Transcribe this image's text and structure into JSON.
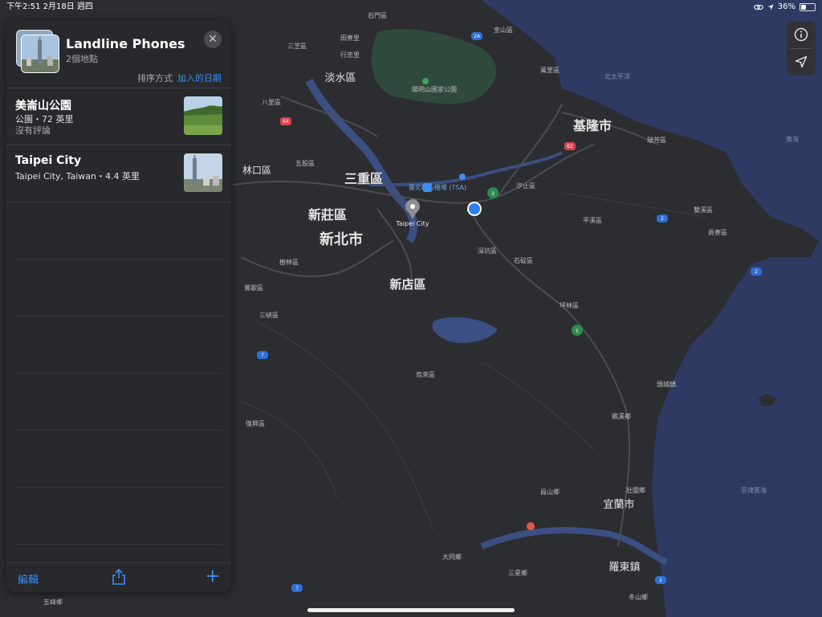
{
  "status_bar": {
    "time_date": "下午2:51  2月18日 週四",
    "battery_text": "36%",
    "battery_level": 0.36
  },
  "panel": {
    "title": "Landline Phones",
    "subtitle": "2個地點",
    "sort_label": "排序方式",
    "sort_value": "加入的日期",
    "items": [
      {
        "title": "美崙山公園",
        "detail": "公園・72 英里",
        "review": "沒有評論",
        "thumb": "park-photo"
      },
      {
        "title": "Taipei City",
        "detail": "Taipei City, Taiwan・4.4 英里",
        "review": "",
        "thumb": "city-skyline-photo"
      }
    ],
    "toolbar": {
      "edit_label": "編輯",
      "add_label": "+"
    }
  },
  "map": {
    "labels_large": [
      {
        "text": "基隆市"
      },
      {
        "text": "三重區"
      },
      {
        "text": "新莊區"
      },
      {
        "text": "新北市"
      },
      {
        "text": "新店區"
      },
      {
        "text": "淡水區"
      },
      {
        "text": "宜蘭市"
      },
      {
        "text": "羅東鎮"
      },
      {
        "text": "林口區"
      }
    ],
    "labels_small": [
      {
        "text": "金山區"
      },
      {
        "text": "萬里區"
      },
      {
        "text": "三芝區"
      },
      {
        "text": "石門區"
      },
      {
        "text": "田寮里"
      },
      {
        "text": "行忠里"
      },
      {
        "text": "陽明山國家公園"
      },
      {
        "text": "八里區"
      },
      {
        "text": "五股區"
      },
      {
        "text": "汐止區"
      },
      {
        "text": "平溪區"
      },
      {
        "text": "雙溪區"
      },
      {
        "text": "貢寮區"
      },
      {
        "text": "瑞芳區"
      },
      {
        "text": "深坑區"
      },
      {
        "text": "石碇區"
      },
      {
        "text": "樹林區"
      },
      {
        "text": "鶯歌區"
      },
      {
        "text": "三峽區"
      },
      {
        "text": "坪林區"
      },
      {
        "text": "烏來區"
      },
      {
        "text": "復興區"
      },
      {
        "text": "頭城鎮"
      },
      {
        "text": "礁溪鄉"
      },
      {
        "text": "員山鄉"
      },
      {
        "text": "壯圍鄉"
      },
      {
        "text": "大同鄉"
      },
      {
        "text": "三星鄉"
      },
      {
        "text": "冬山鄉"
      },
      {
        "text": "五峰鄉"
      },
      {
        "text": "北太平洋"
      },
      {
        "text": "東海"
      },
      {
        "text": "菲律賓海"
      },
      {
        "text": "臺北松山機場 (TSA)"
      },
      {
        "text": "Taipei City"
      }
    ],
    "highway_badges": [
      "2A",
      "64",
      "62",
      "2",
      "2",
      "2",
      "7",
      "7",
      "3",
      "5"
    ],
    "water_color": "#2f3a63",
    "land_color": "#2b2d31"
  }
}
